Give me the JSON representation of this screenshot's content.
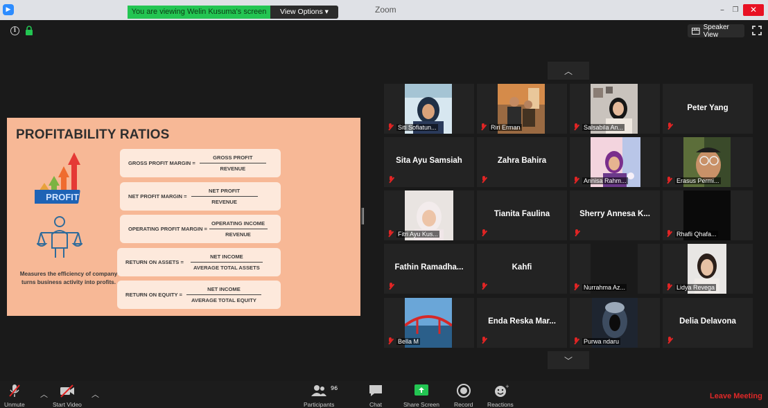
{
  "titlebar": {
    "viewing_banner": "You are viewing Welin Kusuma's screen",
    "view_options": "View Options",
    "window_title": "Zoom"
  },
  "topbar": {
    "speaker_view_label": "Speaker View"
  },
  "slide": {
    "title": "PROFITABILITY RATIOS",
    "graphic_word": "PROFIT",
    "caption": "Measures the efficiency of company turns business activity into profits.",
    "formulas": [
      {
        "name": "GROSS PROFIT MARGIN =",
        "numerator": "GROSS PROFIT",
        "denominator": "REVENUE"
      },
      {
        "name": "NET PROFIT MARGIN   =",
        "numerator": "NET PROFIT",
        "denominator": "REVENUE"
      },
      {
        "name": "OPERATING PROFIT MARGIN =",
        "numerator": "OPERATING INCOME",
        "denominator": "REVENUE"
      },
      {
        "name": "RETURN ON ASSETS =",
        "numerator": "NET INCOME",
        "denominator": "AVERAGE TOTAL ASSETS"
      },
      {
        "name": "RETURN ON EQUITY =",
        "numerator": "NET INCOME",
        "denominator": "AVERAGE TOTAL EQUITY"
      }
    ]
  },
  "gallery": {
    "participants": [
      {
        "name": "Siti Sofiatun...",
        "has_video": true
      },
      {
        "name": "Riri Erman",
        "has_video": true
      },
      {
        "name": "Salsabila An...",
        "has_video": true
      },
      {
        "name": "Peter Yang",
        "has_video": false
      },
      {
        "name": "Sita Ayu Samsiah",
        "has_video": false
      },
      {
        "name": "Zahra Bahira",
        "has_video": false
      },
      {
        "name": "Annisa Rahm...",
        "has_video": true
      },
      {
        "name": "Erasus Permi...",
        "has_video": true
      },
      {
        "name": "Fitri Ayu Kus...",
        "has_video": true
      },
      {
        "name": "Tianita Faulina",
        "has_video": false
      },
      {
        "name": "Sherry Annesa K...",
        "has_video": false
      },
      {
        "name": "Rhafli Qhafa...",
        "has_video": true
      },
      {
        "name": "Fathin Ramadha...",
        "has_video": false
      },
      {
        "name": "Kahfi",
        "has_video": false
      },
      {
        "name": "Nurrahma Az...",
        "has_video": true
      },
      {
        "name": "Lidya Revega",
        "has_video": true
      },
      {
        "name": "Bella M",
        "has_video": true
      },
      {
        "name": "Enda Reska Mar...",
        "has_video": false
      },
      {
        "name": "Purwa ndaru",
        "has_video": true
      },
      {
        "name": "Delia Delavona",
        "has_video": false
      }
    ]
  },
  "toolbar": {
    "unmute": "Unmute",
    "start_video": "Start Video",
    "participants": "Participants",
    "participant_count": "96",
    "chat": "Chat",
    "share_screen": "Share Screen",
    "record": "Record",
    "reactions": "Reactions",
    "leave": "Leave Meeting"
  },
  "colors": {
    "slide_bg": "#f7b896",
    "share_green": "#23c552",
    "leave_red": "#e02828",
    "mute_red": "#e02424"
  }
}
